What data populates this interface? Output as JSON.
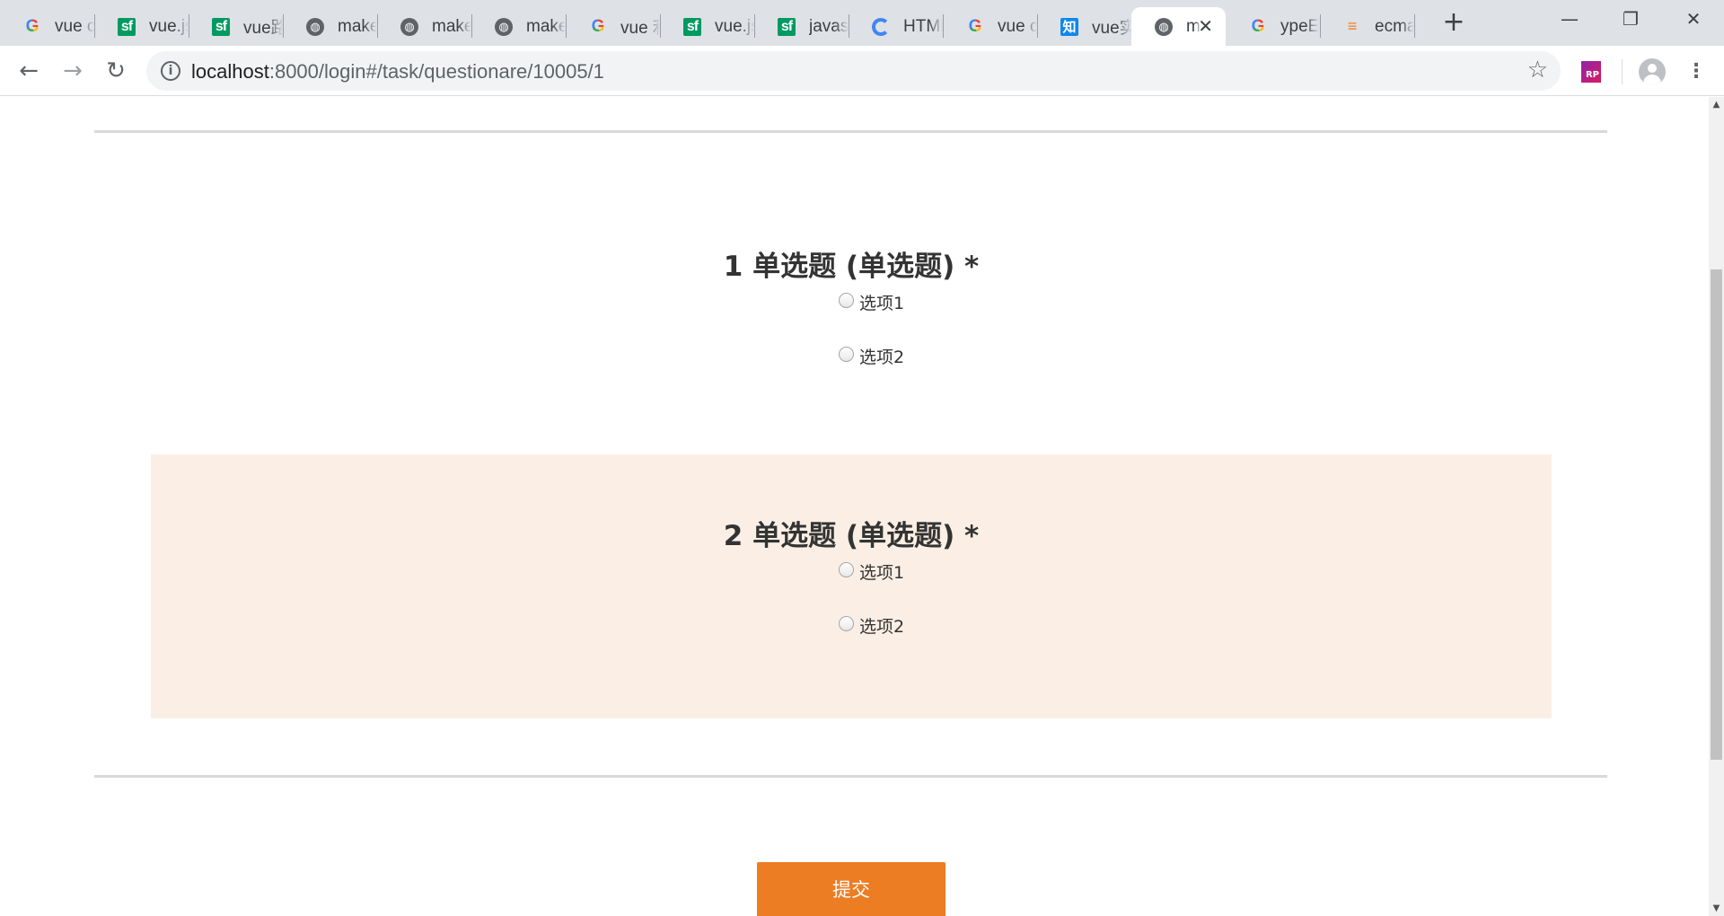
{
  "browser": {
    "tabs": [
      {
        "title": "vue c",
        "favicon": "google-g",
        "active": false
      },
      {
        "title": "vue.js",
        "favicon": "sf",
        "active": false
      },
      {
        "title": "vue路",
        "favicon": "sf",
        "active": false
      },
      {
        "title": "make",
        "favicon": "globe",
        "active": false
      },
      {
        "title": "make",
        "favicon": "globe",
        "active": false
      },
      {
        "title": "make",
        "favicon": "globe",
        "active": false
      },
      {
        "title": "vue 利",
        "favicon": "google-g",
        "active": false
      },
      {
        "title": "vue.js",
        "favicon": "sf",
        "active": false
      },
      {
        "title": "javas",
        "favicon": "sf",
        "active": false
      },
      {
        "title": "HTML",
        "favicon": "c-circle",
        "active": false
      },
      {
        "title": "vue c",
        "favicon": "google-g",
        "active": false
      },
      {
        "title": "vue实",
        "favicon": "zhihu",
        "active": false
      },
      {
        "title": "m",
        "favicon": "globe",
        "active": true
      },
      {
        "title": "ypeE",
        "favicon": "google-g",
        "active": false
      },
      {
        "title": "ecma",
        "favicon": "stackoverflow",
        "active": false
      }
    ],
    "favicon_glyphs": {
      "google-g": "G",
      "sf": "sf",
      "globe": "◍",
      "c-circle": "",
      "zhihu": "知",
      "stackoverflow": "≡"
    },
    "new_tab_glyph": "+",
    "close_tab_glyph": "✕",
    "window_controls": {
      "minimize": "—",
      "restore": "❐",
      "close": "✕"
    },
    "nav": {
      "back": "←",
      "forward": "→",
      "reload": "↻"
    },
    "address": {
      "host": "localhost",
      "rest": ":8000/login#/task/questionare/10005/1",
      "info_glyph": "i",
      "bookmark_glyph": "☆"
    },
    "extension_label": "RP",
    "menu_glyph": "⋮"
  },
  "scrollbar": {
    "up": "▲",
    "down": "▼"
  },
  "colors": {
    "highlight_bg": "#fbefe5",
    "submit_bg": "#ec7d23",
    "divider": "#d9d9d9",
    "text": "#333333"
  },
  "questions": [
    {
      "title": "1 单选题 (单选题) *",
      "options": [
        "选项1",
        "选项2"
      ],
      "highlighted": false
    },
    {
      "title": "2 单选题 (单选题) *",
      "options": [
        "选项1",
        "选项2"
      ],
      "highlighted": true
    }
  ],
  "submit_label": "提交"
}
